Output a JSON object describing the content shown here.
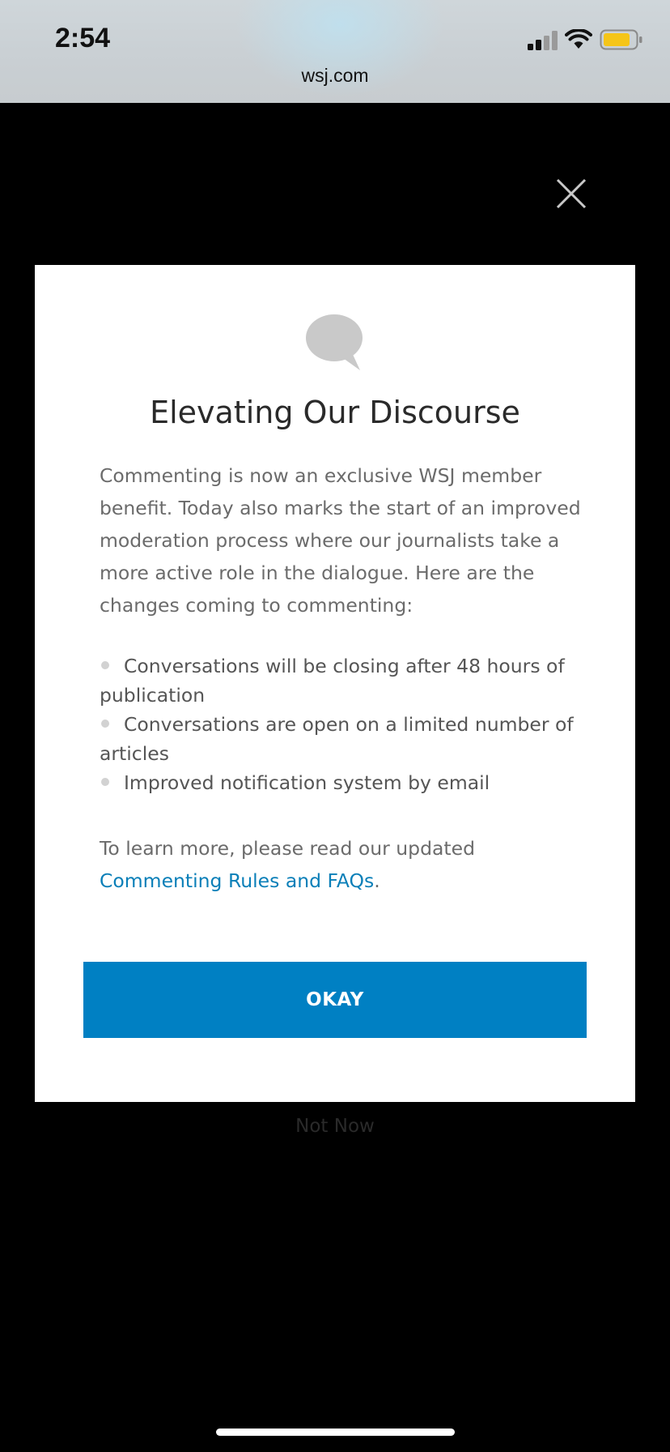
{
  "status_bar": {
    "time": "2:54",
    "url": "wsj.com",
    "signal_icon": "cellular-signal-icon",
    "wifi_icon": "wifi-icon",
    "battery_icon": "battery-icon",
    "battery_color": "#f5c518"
  },
  "overlay": {
    "close_icon": "close-icon",
    "background_color": "#000000"
  },
  "modal": {
    "icon": "speech-bubble-icon",
    "title": "Elevating Our Discourse",
    "intro": "Commenting is now an exclusive WSJ member benefit. Today also marks the start of an improved moderation process where our journalists take a more active role in the dialogue. Here are the changes coming to commenting:",
    "bullets": [
      "Conversations will be closing after 48 hours of publication",
      "Conversations are open on a limited number of articles",
      "Improved notification system by email"
    ],
    "learn_prefix": "To learn more, please read our updated",
    "learn_link": "Commenting Rules and FAQs",
    "learn_suffix": ".",
    "okay_label": "OKAY",
    "accent_color": "#0080c3",
    "link_color": "#0a7fb8"
  },
  "not_now_label": "Not Now"
}
